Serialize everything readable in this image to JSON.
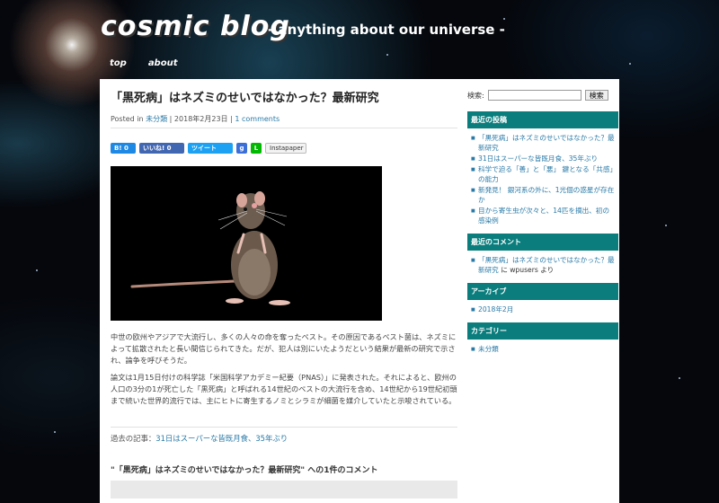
{
  "header": {
    "site_title": "cosmic blog",
    "tagline": "- anything about our universe -",
    "nav": [
      "top",
      "about"
    ]
  },
  "post": {
    "title": "「黒死病」はネズミのせいではなかった？最新研究",
    "meta_prefix": "Posted in",
    "category": "未分類",
    "date": "2018年2月23日",
    "comments_link": "1 comments",
    "share": {
      "hatena": "B! 0",
      "facebook": "いいね! 0",
      "twitter": "ツイート",
      "google": "g",
      "line": "L",
      "instapaper": "Instapaper"
    },
    "paragraphs": [
      "中世の欧州やアジアで大流行し、多くの人々の命を奪ったペスト。その原因であるペスト菌は、ネズミによって拡散されたと長い間信じられてきた。だが、犯人は別にいたようだという結果が最新の研究で示され、論争を呼びそうだ。",
      "論文は1月15日付けの科学誌「米国科学アカデミー紀要（PNAS）」に発表された。それによると、欧州の人口の3分の1が死亡した「黒死病」と呼ばれる14世紀のペストの大流行を含め、14世紀から19世紀初頭まで続いた世界的流行では、主にヒトに寄生するノミとシラミが細菌を媒介していたと示唆されている。"
    ],
    "past_label": "過去の記事：",
    "past_link": "31日はスーパーな皆既月食、35年ぶり",
    "comments_heading": "\"「黒死病」はネズミのせいではなかった？最新研究\" への1件のコメント"
  },
  "sidebar": {
    "search_label": "検索:",
    "search_value": "",
    "search_button": "検索",
    "recent_posts_title": "最近の投稿",
    "recent_posts": [
      "「黒死病」はネズミのせいではなかった？最新研究",
      "31日はスーパーな皆既月食、35年ぶり",
      "科学で迫る「善」と「悪」 鍵となる「共感」の能力",
      "新発見！ 銀河系の外に、1光個の惑星が存在か",
      "目から寄生虫が次々と、14匹を摘出、初の感染例"
    ],
    "recent_comments_title": "最近のコメント",
    "recent_comment": {
      "post": "「黒死病」はネズミのせいではなかった？最新研究",
      "connector": "に",
      "author": "wpusers",
      "suffix": "より"
    },
    "archive_title": "アーカイブ",
    "archives": [
      "2018年2月"
    ],
    "categories_title": "カテゴリー",
    "categories": [
      "未分類"
    ]
  },
  "colors": {
    "widget_header": "#0b7d7d",
    "link": "#2a7aa7"
  }
}
